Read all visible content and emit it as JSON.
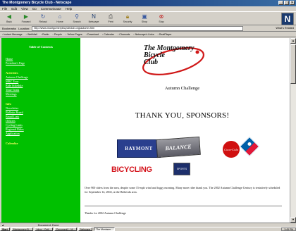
{
  "window": {
    "title": "The Montgomery Bicycle Club - Netscape"
  },
  "menu": [
    "File",
    "Edit",
    "View",
    "Go",
    "Communicator",
    "Help"
  ],
  "toolbar": [
    "Back",
    "Forward",
    "Reload",
    "Home",
    "Search",
    "Netscape",
    "Print",
    "Security",
    "Shop",
    "Stop"
  ],
  "location": {
    "bookmarks_label": "Bookmarks",
    "label": "Location:",
    "url": "http://www.montgomerybicycleclub.org/autumn.htm",
    "related_label": "What's Related"
  },
  "personal": [
    "Instant Message",
    "WebMail",
    "Radio",
    "People",
    "Yellow Pages",
    "Download",
    "Calendar",
    "Channels",
    "Netscape's Links",
    "RealPlayer"
  ],
  "sidebar": {
    "toc": "Table of Contents",
    "items": [
      {
        "label": "Home",
        "head": false
      },
      {
        "label": "President's Page",
        "head": false
      },
      {
        "label": "Activities",
        "head": true
      },
      {
        "label": "Autumn Challenge",
        "head": false
      },
      {
        "label": "MBC Tour",
        "head": false
      },
      {
        "label": "Ride Schedule",
        "head": false
      },
      {
        "label": "Time Trials",
        "head": false
      },
      {
        "label": "Meetings",
        "head": false
      },
      {
        "label": "Info",
        "head": true
      },
      {
        "label": "Newsletter",
        "head": false
      },
      {
        "label": "Bulletin Board",
        "head": false
      },
      {
        "label": "Email Lists",
        "head": false
      },
      {
        "label": "Officers",
        "head": false
      },
      {
        "label": "Cycling Links",
        "head": false
      },
      {
        "label": "Regional Rides",
        "head": false
      },
      {
        "label": "Application",
        "head": false
      },
      {
        "label": "Calendar",
        "head": true
      }
    ]
  },
  "main": {
    "logo": [
      "The Montgomery",
      "Bicycle",
      "Club"
    ],
    "event_title": "Autumn Challenge",
    "thanks": "THANK YOU, SPONSORS!",
    "sponsors": {
      "baymont": "BAYMONT",
      "balance": "BALANCE",
      "coke": "Coca-Cola",
      "bicycling": "BICYCLING",
      "small": "SPORTS"
    },
    "paragraph": "Over 900 riders from the area, despite some 15-mph wind and foggy morning. Many more rider thank you. The 2002 Autumn Challenge Century is tentatively scheduled for September 14, 2002, at the Bethesda area.",
    "footer": "Thanks for 2002 Autumn Challenge"
  },
  "status": {
    "progress": "",
    "document": "Document: Done"
  },
  "taskbar": {
    "start": "Start",
    "tasks": [
      "Montgomery B...",
      "Inbox - Outl...",
      "Document1 - M...",
      "Netscape",
      "The Montgom..."
    ],
    "clock": "3:45 PM"
  }
}
